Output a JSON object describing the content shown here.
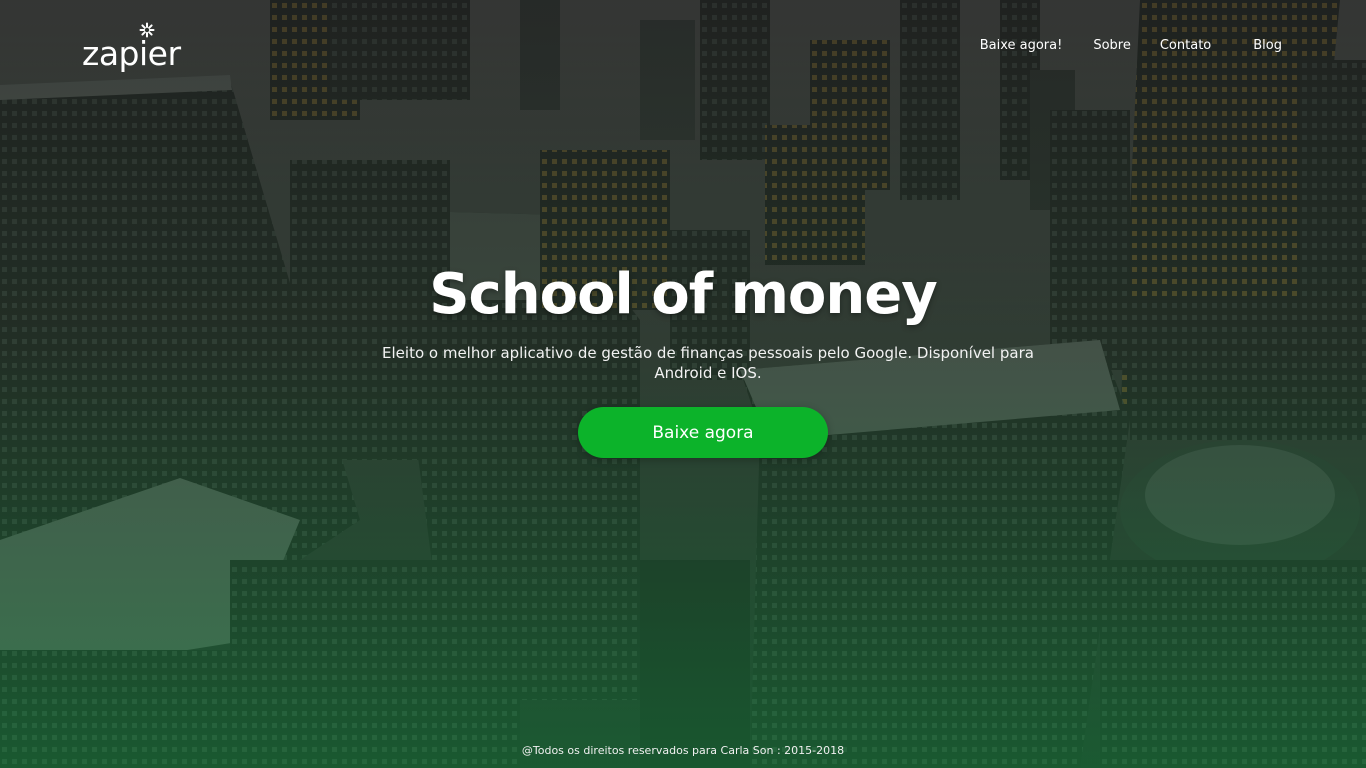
{
  "brand": {
    "logo_text": "zapier"
  },
  "nav": {
    "items": [
      {
        "label": "Baixe agora!"
      },
      {
        "label": "Sobre"
      },
      {
        "label": "Contato"
      },
      {
        "label": "Blog"
      }
    ]
  },
  "hero": {
    "title": "School of money",
    "subtitle": "Eleito o melhor aplicativo de gestão de finanças pessoais pelo Google. Disponível para Android e IOS.",
    "cta_label": "Baixe agora"
  },
  "footer": {
    "text": "@Todos os direitos reservados para Carla Son : 2015-2018"
  },
  "colors": {
    "accent": "#0cb32a",
    "overlay_bottom": "#138a3a"
  }
}
